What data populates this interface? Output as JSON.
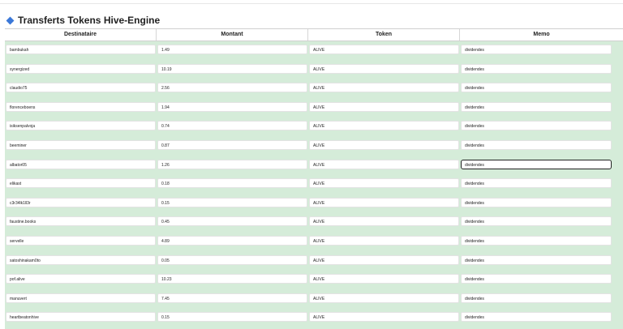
{
  "page": {
    "title": "Transferts Tokens Hive-Engine"
  },
  "table": {
    "columns": [
      "Destinataire",
      "Montant",
      "Token",
      "Memo"
    ],
    "rows": [
      {
        "recipient": "bambukah",
        "amount": "1.49",
        "token": "ALIVE",
        "memo": "dividendes"
      },
      {
        "recipient": "synergized",
        "amount": "10.19",
        "token": "ALIVE",
        "memo": "dividendes"
      },
      {
        "recipient": "claudio75",
        "amount": "2.56",
        "token": "ALIVE",
        "memo": "dividendes"
      },
      {
        "recipient": "florenceboens",
        "amount": "1.94",
        "token": "ALIVE",
        "memo": "dividendes"
      },
      {
        "recipient": "isiksenpalvoja",
        "amount": "0.74",
        "token": "ALIVE",
        "memo": "dividendes"
      },
      {
        "recipient": "beeminer",
        "amount": "0.87",
        "token": "ALIVE",
        "memo": "dividendes"
      },
      {
        "recipient": "albator05",
        "amount": "1.26",
        "token": "ALIVE",
        "memo": "dividendes"
      },
      {
        "recipient": "elikast",
        "amount": "0.18",
        "token": "ALIVE",
        "memo": "dividendes"
      },
      {
        "recipient": "c3r34lk1ll3r",
        "amount": "0.15",
        "token": "ALIVE",
        "memo": "dividendes"
      },
      {
        "recipient": "faustine.books",
        "amount": "0.45",
        "token": "ALIVE",
        "memo": "dividendes"
      },
      {
        "recipient": "servelle",
        "amount": "4.89",
        "token": "ALIVE",
        "memo": "dividendes"
      },
      {
        "recipient": "satoshinakam0to",
        "amount": "0.05",
        "token": "ALIVE",
        "memo": "dividendes"
      },
      {
        "recipient": "pof.alive",
        "amount": "10.23",
        "token": "ALIVE",
        "memo": "dividendes"
      },
      {
        "recipient": "manuvert",
        "amount": "7.45",
        "token": "ALIVE",
        "memo": "dividendes"
      },
      {
        "recipient": "heartbeatonhive",
        "amount": "0.15",
        "token": "ALIVE",
        "memo": "dividendes"
      }
    ]
  },
  "colors": {
    "accent": "#3b78d8",
    "row_background": "#d5ecd9"
  }
}
